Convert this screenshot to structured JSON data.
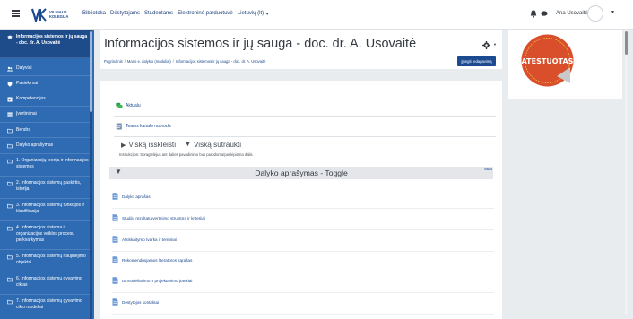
{
  "navbar": {
    "menu_icon": "hamburger-icon",
    "logo": {
      "line1": "VILNIAUS",
      "line2": "KOLEGIJA"
    },
    "links": [
      "Biblioteka",
      "Dėstytojams",
      "Studentams",
      "Elektroninė parduotuvė"
    ],
    "language": "Lietuvių (lt)",
    "username": "Ana Usovaitė",
    "icons": {
      "bell": "bell-icon",
      "chat": "chat-icon"
    }
  },
  "sidebar": {
    "items": [
      {
        "label": "Informacijos sistemos ir jų sauga - doc. dr. A. Usovaitė",
        "icon": "graduation-cap-icon",
        "active": true
      },
      {
        "label": "Dalyviai",
        "icon": "users-icon"
      },
      {
        "label": "Pasiekimai",
        "icon": "shield-icon"
      },
      {
        "label": "Kompetencijos",
        "icon": "checkbox-icon"
      },
      {
        "label": "Įvertinimai",
        "icon": "grid-icon"
      },
      {
        "label": "Bendra",
        "icon": "folder-icon"
      },
      {
        "label": "Dalyko aprašymas",
        "icon": "folder-icon"
      },
      {
        "label": "1. Organizacijų teorija ir informacijos sistemos",
        "icon": "folder-icon"
      },
      {
        "label": "2. Informacijos sistemų paskirtis, istorija",
        "icon": "folder-icon"
      },
      {
        "label": "3. Informacijos sistemų funkcijos ir klasifikacija",
        "icon": "folder-icon"
      },
      {
        "label": "4. Informacijos sistema ir organizacijos veiklos procesų perkvarkymas",
        "icon": "folder-icon"
      },
      {
        "label": "5. Informacijos sistemų naujinėjimo objektai",
        "icon": "folder-icon"
      },
      {
        "label": "6. Informacijos sistemų gyvavimo ciklas",
        "icon": "folder-icon"
      },
      {
        "label": "7. Informacijos sistemų gyvavimo ciklo modeliai",
        "icon": "folder-icon"
      }
    ]
  },
  "header": {
    "title": "Informacijos sistemos ir jų sauga - doc. dr. A. Usovaitė",
    "breadcrumb": [
      "Pagrindinis",
      "Mano e. dalykai (moduliai)",
      "Informacijos sistemos ir jų sauga - doc. dr. A. Usovaitė"
    ],
    "edit_button": "Įjungti redagavimą",
    "gear_icon": "gear-icon"
  },
  "badge": {
    "text": "ATESTUOTAS",
    "color": "#d94f2b"
  },
  "main": {
    "top_links": [
      {
        "label": "Aktualu",
        "icon": "forum-icon"
      },
      {
        "label": "Teams kanalo nuoroda",
        "icon": "link-icon"
      }
    ],
    "expand_all": "Viską išskleisti",
    "collapse_all": "Viską sutraukti",
    "instructions": "Instrukcijos: Spragtelėjus ant dalies pavadinimo bus parodoma/paslėpiama dalis.",
    "toggle": {
      "title": "Dalyko aprašymas - Toggle",
      "tag": "Nauja"
    },
    "files": [
      "Dalyko aprašas",
      "Studijų rezultatų vertinimo struktūra ir kriterijai",
      "Atsiskaitymo tvarka ir terminai",
      "Rekomenduojamos literatūros sąrašas",
      "IS modeliavimo ir projektavimo įrankiai",
      "Dėstytojos kontaktai"
    ]
  },
  "colors": {
    "sidebar": "#2f6bb3",
    "primary": "#1b4a91"
  }
}
